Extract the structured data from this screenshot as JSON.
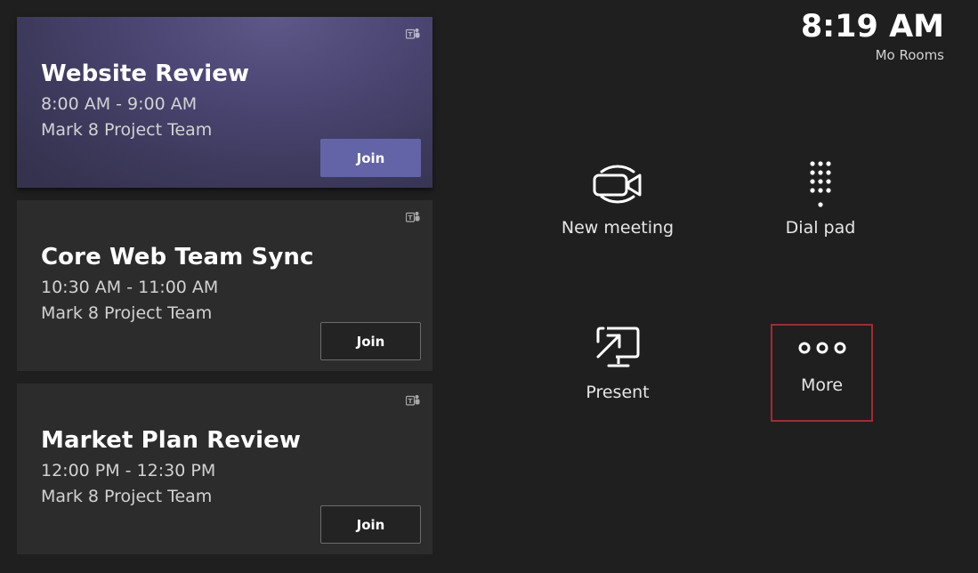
{
  "clock": {
    "time": "8:19 AM",
    "room": "Mo Rooms"
  },
  "meetings": [
    {
      "title": "Website Review",
      "time": "8:00 AM - 9:00 AM",
      "team": "Mark 8 Project Team",
      "join_label": "Join",
      "icon": "teams-icon",
      "active": true
    },
    {
      "title": "Core Web Team Sync",
      "time": "10:30 AM - 11:00 AM",
      "team": "Mark 8 Project Team",
      "join_label": "Join",
      "icon": "teams-icon",
      "active": false
    },
    {
      "title": "Market Plan Review",
      "time": "12:00 PM - 12:30 PM",
      "team": "Mark 8 Project Team",
      "join_label": "Join",
      "icon": "teams-icon",
      "active": false
    }
  ],
  "actions": {
    "new_meeting": {
      "label": "New meeting",
      "icon": "video-camera-icon"
    },
    "dial_pad": {
      "label": "Dial pad",
      "icon": "dial-pad-icon"
    },
    "present": {
      "label": "Present",
      "icon": "present-screen-icon"
    },
    "more": {
      "label": "More",
      "icon": "ellipsis-icon"
    }
  },
  "colors": {
    "background": "#1f1f1f",
    "card": "#2c2c2c",
    "active_card": "#4d4775",
    "join_accent": "#6264a7",
    "focus_outline": "#a42a30"
  }
}
